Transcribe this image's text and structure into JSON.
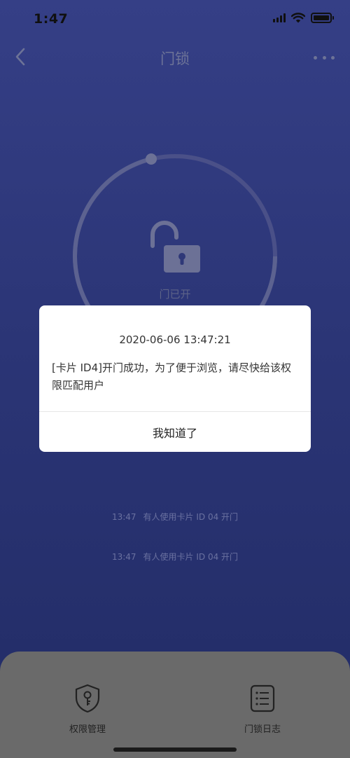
{
  "status_bar": {
    "time": "1:47"
  },
  "nav": {
    "title": "门锁"
  },
  "lock": {
    "status": "门已开"
  },
  "dialog": {
    "timestamp": "2020-06-06 13:47:21",
    "message": "[卡片 ID4]开门成功，为了便于浏览，请尽快给该权限匹配用户",
    "confirm_label": "我知道了"
  },
  "logs": [
    {
      "time": "13:47",
      "text": "有人使用卡片 ID 04 开门"
    },
    {
      "time": "13:47",
      "text": "有人使用卡片 ID 04 开门"
    }
  ],
  "tabbar": {
    "items": [
      {
        "label": "权限管理",
        "icon": "shield-key-icon"
      },
      {
        "label": "门锁日志",
        "icon": "log-list-icon"
      }
    ]
  },
  "colors": {
    "background_top": "#353f86",
    "background_bottom": "#222c66",
    "ring": "#5c6290",
    "tabbar": "#6a6a6a"
  }
}
